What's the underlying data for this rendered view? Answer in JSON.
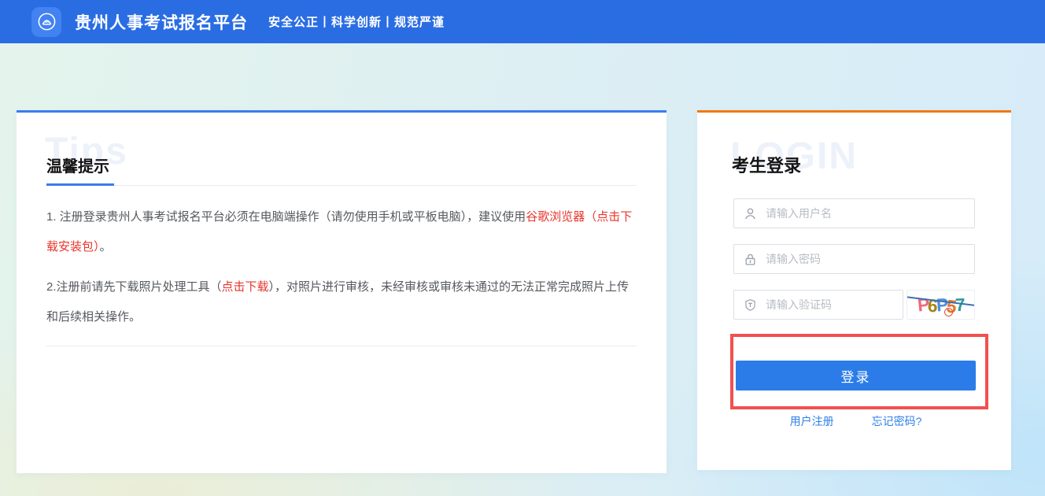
{
  "header": {
    "title": "贵州人事考试报名平台",
    "slogan": "安全公正丨科学创新丨规范严谨",
    "bg_color": "#2a6de3"
  },
  "tips": {
    "watermark": "Tips",
    "heading": "温馨提示",
    "tip1": {
      "text_start": "1. 注册登录贵州人事考试报名平台必须在电脑端操作（请勿使用手机或平板电脑），建议使用",
      "browser_link": "谷歌浏览器",
      "download_link": "（点击下载安装包）",
      "text_end": "。"
    },
    "tip2": {
      "text_start": "2.注册前请先下载照片处理工具（",
      "download_link": "点击下载",
      "text_end": "），对照片进行审核，未经审核或审核未通过的无法正常完成照片上传和后续相关操作。"
    }
  },
  "login": {
    "watermark": "LOGIN",
    "heading": "考生登录",
    "username_placeholder": "请输入用户名",
    "password_placeholder": "请输入密码",
    "captcha_placeholder": "请输入验证码",
    "captcha_text": "P6P57",
    "captcha_chars": [
      {
        "ch": "P",
        "color": "#ef6a7a"
      },
      {
        "ch": "6",
        "color": "#a78419"
      },
      {
        "ch": "P",
        "color": "#4f8fdd"
      },
      {
        "ch": "5",
        "color": "#e2772e"
      },
      {
        "ch": "7",
        "color": "#2e9e96"
      }
    ],
    "login_button": "登录",
    "register_link": "用户注册",
    "forgot_link": "忘记密码?"
  },
  "colors": {
    "header_blue": "#2a6de3",
    "button_blue": "#2b7ce9",
    "tips_accent_blue": "#3b7bf0",
    "login_accent_orange": "#f0790e",
    "annotation_red": "#f25050",
    "warning_text_red": "#e8352c",
    "link_blue": "#2f80e8"
  }
}
